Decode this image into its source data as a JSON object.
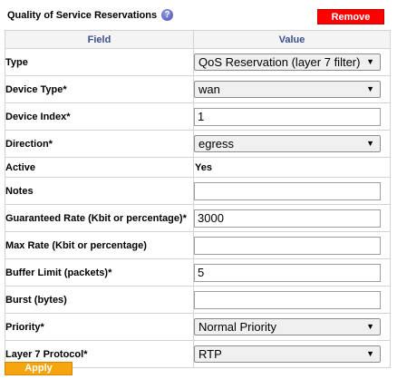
{
  "header": {
    "title": "Quality of Service Reservations",
    "help_icon": "question-icon",
    "remove_label": "Remove"
  },
  "table": {
    "col_field": "Field",
    "col_value": "Value",
    "rows": {
      "type": {
        "label": "Type",
        "value": "QoS Reservation (layer 7 filter)"
      },
      "device_type": {
        "label": "Device Type*",
        "value": "wan"
      },
      "device_index": {
        "label": "Device Index*",
        "value": "1"
      },
      "direction": {
        "label": "Direction*",
        "value": "egress"
      },
      "active": {
        "label": "Active",
        "value": "Yes"
      },
      "notes": {
        "label": "Notes",
        "value": ""
      },
      "guaranteed_rate": {
        "label": "Guaranteed Rate (Kbit or percentage)*",
        "value": "3000"
      },
      "max_rate": {
        "label": "Max Rate (Kbit or percentage)",
        "value": ""
      },
      "buffer_limit": {
        "label": "Buffer Limit (packets)*",
        "value": "5"
      },
      "burst": {
        "label": "Burst (bytes)",
        "value": ""
      },
      "priority": {
        "label": "Priority*",
        "value": "Normal Priority"
      },
      "l7_protocol": {
        "label": "Layer 7 Protocol*",
        "value": "RTP"
      }
    }
  },
  "footer": {
    "apply_label": "Apply"
  },
  "colors": {
    "remove_button": "#ff0000",
    "apply_button": "#f6a50e",
    "header_text": "#3a4f8f"
  }
}
